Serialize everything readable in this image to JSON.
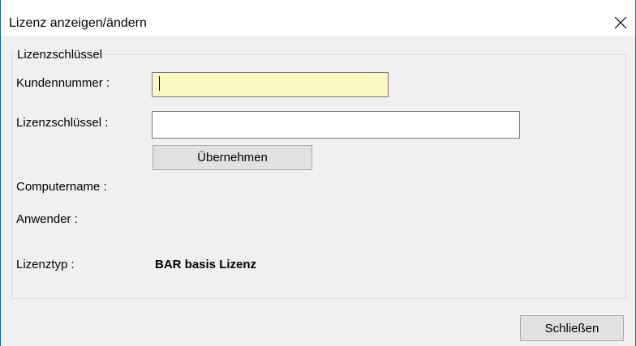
{
  "window": {
    "title": "Lizenz anzeigen/ändern"
  },
  "group": {
    "legend": "Lizenzschlüssel"
  },
  "fields": {
    "kundennummer_label": "Kundennummer :",
    "kundennummer_value": "",
    "lizenzschluessel_label": "Lizenzschlüssel :",
    "lizenzschluessel_value": "",
    "uebernehmen_label": "Übernehmen",
    "computername_label": "Computername :",
    "anwender_label": "Anwender :",
    "lizenztyp_label": "Lizenztyp :",
    "lizenztyp_value": "BAR basis Lizenz"
  },
  "footer": {
    "close_label": "Schließen"
  },
  "colors": {
    "focused_input_bg": "#fcf8c6",
    "window_border": "#1b5fa8"
  },
  "icons": {
    "close": "close-icon"
  }
}
